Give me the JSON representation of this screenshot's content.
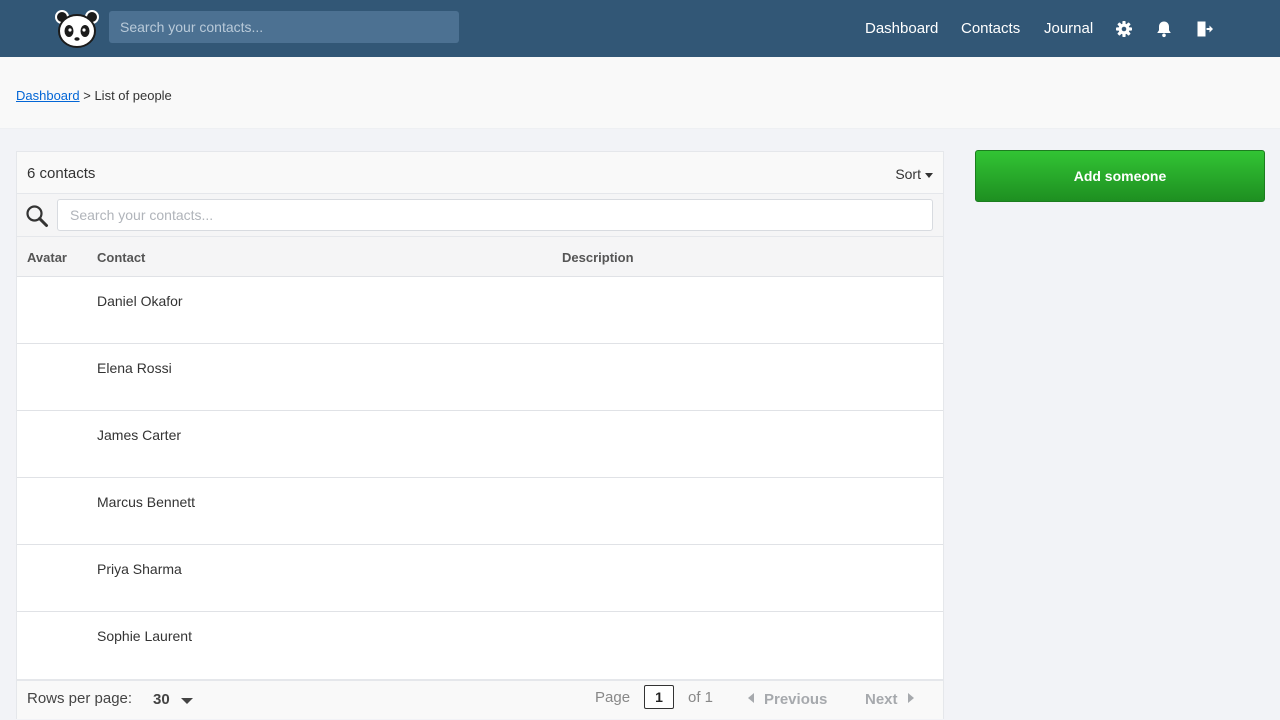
{
  "header": {
    "search_placeholder": "Search your contacts...",
    "nav": {
      "dashboard": "Dashboard",
      "contacts": "Contacts",
      "journal": "Journal"
    },
    "icons": [
      "panda-logo-icon",
      "gear-icon",
      "bell-icon",
      "logout-icon"
    ],
    "background_color": "#325776"
  },
  "breadcrumb": {
    "link": "Dashboard",
    "separator": ">",
    "current": "List of people"
  },
  "list": {
    "count_label": "6 contacts",
    "sort_label": "Sort",
    "search_placeholder": "Search your contacts...",
    "columns": {
      "avatar": "Avatar",
      "contact": "Contact",
      "description": "Description"
    },
    "rows": [
      {
        "name": "Daniel Okafor",
        "description": ""
      },
      {
        "name": "Elena Rossi",
        "description": ""
      },
      {
        "name": "James Carter",
        "description": ""
      },
      {
        "name": "Marcus Bennett",
        "description": ""
      },
      {
        "name": "Priya Sharma",
        "description": ""
      },
      {
        "name": "Sophie Laurent",
        "description": ""
      }
    ]
  },
  "pagination": {
    "rows_per_page_label": "Rows per page:",
    "rows_per_page_value": "30",
    "page_label": "Page",
    "page_value": "1",
    "of_label": "of 1",
    "previous_label": "Previous",
    "next_label": "Next"
  },
  "actions": {
    "add_label": "Add someone",
    "add_color": "#2fb832"
  }
}
